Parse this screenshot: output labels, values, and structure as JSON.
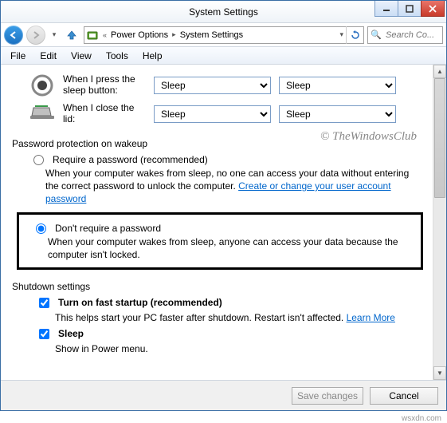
{
  "window": {
    "title": "System Settings"
  },
  "nav": {
    "breadcrumb_prefix": "«",
    "crumb1": "Power Options",
    "crumb2": "System Settings",
    "search_placeholder": "Search Co..."
  },
  "menu": {
    "file": "File",
    "edit": "Edit",
    "view": "View",
    "tools": "Tools",
    "help": "Help"
  },
  "sleep_button": {
    "label": "When I press the sleep button:",
    "battery": "Sleep",
    "plugged": "Sleep"
  },
  "lid": {
    "label": "When I close the lid:",
    "battery": "Sleep",
    "plugged": "Sleep"
  },
  "password_section": {
    "title": "Password protection on wakeup",
    "require": {
      "label": "Require a password (recommended)",
      "desc_a": "When your computer wakes from sleep, no one can access your data without entering the correct password to unlock the computer. ",
      "link": "Create or change your user account password"
    },
    "dont_require": {
      "label": "Don't require a password",
      "desc": "When your computer wakes from sleep, anyone can access your data because the computer isn't locked."
    }
  },
  "shutdown_section": {
    "title": "Shutdown settings",
    "fast_startup": {
      "label": "Turn on fast startup (recommended)",
      "desc_a": "This helps start your PC faster after shutdown. Restart isn't affected. ",
      "link": "Learn More"
    },
    "sleep": {
      "label": "Sleep",
      "desc": "Show in Power menu."
    }
  },
  "buttons": {
    "save": "Save changes",
    "cancel": "Cancel"
  },
  "watermark": "© TheWindowsClub",
  "attribution": "wsxdn.com"
}
